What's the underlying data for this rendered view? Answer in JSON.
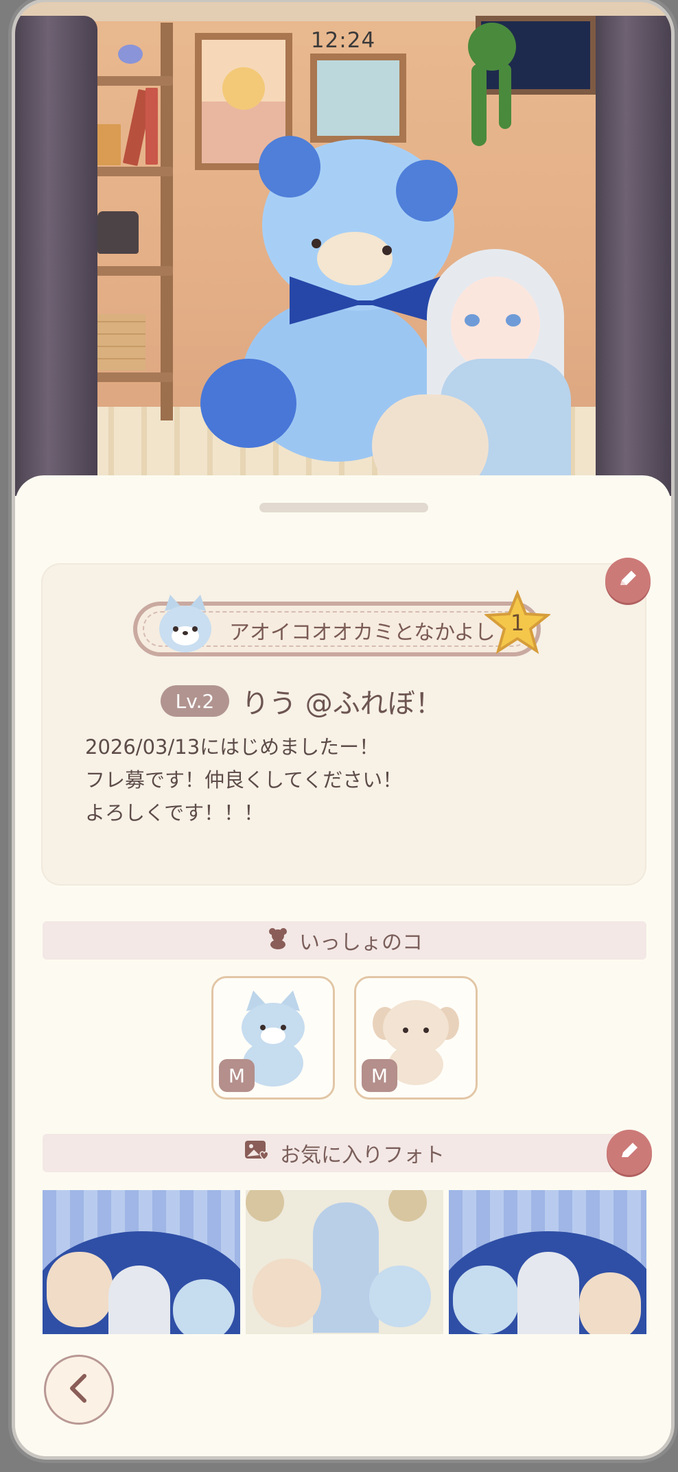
{
  "status_bar": {
    "time": "12:24"
  },
  "profile": {
    "friend_title": "アオイコオオカミとなかよし",
    "friend_rank": "1",
    "level": "Lv.2",
    "username": "りう @ふれぼ！",
    "bio_lines": [
      "2026/03/13にはじめましたー！",
      "フレ募です！仲良くしてください！",
      "よろしくです！！！"
    ]
  },
  "companions": {
    "heading": "いっしょのコ",
    "items": [
      {
        "name": "blue-wolf",
        "size_badge": "M",
        "color": "#b9d4ea"
      },
      {
        "name": "cream-puppy",
        "size_badge": "M",
        "color": "#efdcc8"
      }
    ]
  },
  "photos": {
    "heading": "お気に入りフォト",
    "count": 3
  },
  "colors": {
    "accent": "#cc7a78",
    "sheet": "#fdfbf1",
    "text": "#6d5552"
  },
  "icons": {
    "edit": "pencil-icon",
    "companions": "teddy-bear-icon",
    "photos": "photo-heart-icon",
    "back": "chevron-left-icon"
  }
}
